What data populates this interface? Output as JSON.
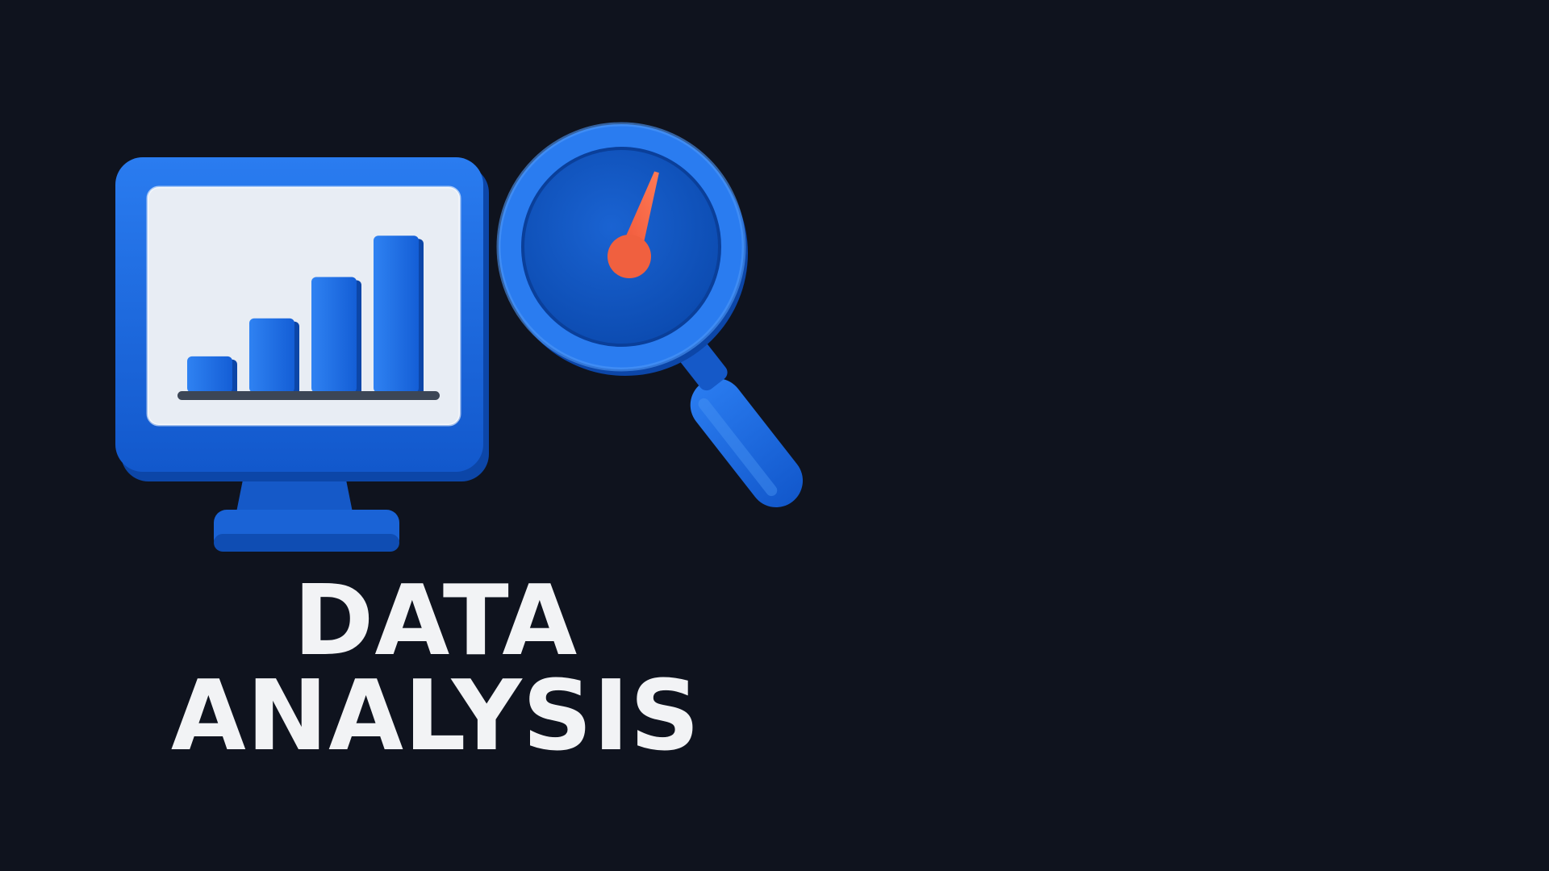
{
  "headline": {
    "line1": "DATA",
    "line2": "ANALYSIS"
  },
  "illustration": {
    "monitor_icon": "monitor-bar-chart-icon",
    "magnifier_icon": "magnifying-glass-gauge-icon",
    "bar_levels": [
      0.22,
      0.45,
      0.7,
      0.95
    ],
    "gauge_level": 0.8
  },
  "colors": {
    "background": "#0f131e",
    "primary_blue": "#1f6ee0",
    "dark_blue": "#0d56c2",
    "screen_light": "#e8edf4",
    "needle": "#f0603f",
    "text": "#f2f3f5",
    "baseline": "#3c4656"
  }
}
